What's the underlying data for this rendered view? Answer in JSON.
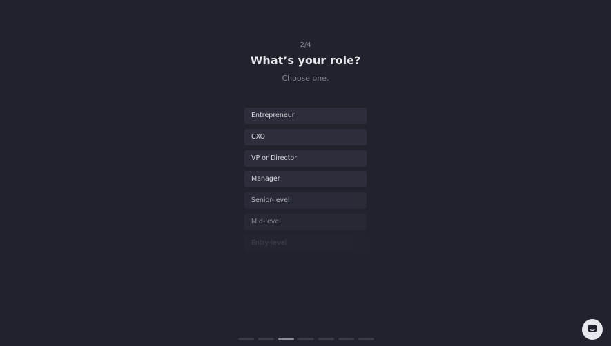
{
  "onboarding": {
    "step": "2/4",
    "title": "What’s your role?",
    "subtitle": "Choose one.",
    "options": [
      {
        "label": "Entrepreneur"
      },
      {
        "label": "CXO"
      },
      {
        "label": "VP or Director"
      },
      {
        "label": "Manager"
      },
      {
        "label": "Senior-level"
      },
      {
        "label": "Mid-level"
      },
      {
        "label": "Entry-level"
      }
    ]
  },
  "progress": {
    "total_segments": 7,
    "active_segment": 3
  },
  "chat_launcher": {
    "icon": "chat-icon"
  },
  "colors": {
    "background": "#20222c",
    "option_background": "#2c2f3b",
    "title": "#e9eaee",
    "launcher": "#e7e8ed"
  }
}
